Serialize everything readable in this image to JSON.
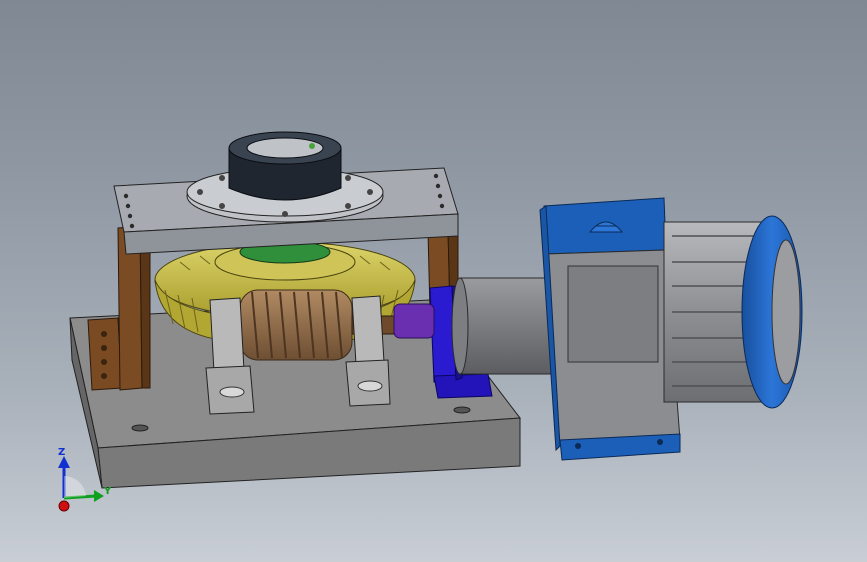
{
  "scene": {
    "description_visible": false,
    "background_gradient": [
      "#7f8893",
      "#c9ced5"
    ],
    "colors": {
      "base_plate": "#8a8a8a",
      "top_plate": "#a4a8ad",
      "worm_gear": "#c8c04a",
      "worm": "#9a7a5a",
      "bracket_brown": "#7a4a22",
      "motor_blue": "#1c5fb8",
      "motor_body": "#8e9094",
      "coupling_purple": "#6a2fb0",
      "mount_blue": "#2a1ad0",
      "hub_dark": "#1f2630",
      "green_ring": "#2f8f3a"
    }
  },
  "triad": {
    "z_label": "Z",
    "y_label": "Y",
    "x_color": "#d01010",
    "y_color": "#10a020",
    "z_color": "#1030d0"
  }
}
